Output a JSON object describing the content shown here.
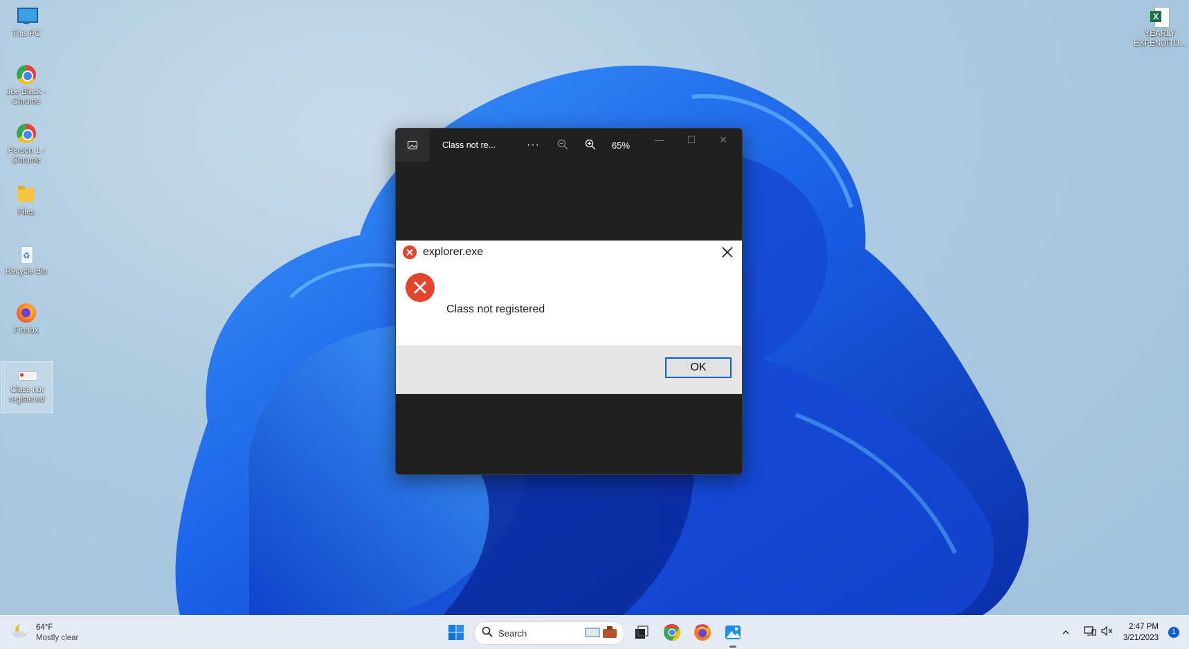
{
  "desktop": {
    "icons": [
      {
        "label": "This PC"
      },
      {
        "label": "Joe Black - Chrome"
      },
      {
        "label": "Person 1 - Chrome"
      },
      {
        "label": "Files"
      },
      {
        "label": "Recycle Bin"
      },
      {
        "label": "Firefox"
      },
      {
        "label": "Class not registered"
      },
      {
        "label": "YEARLY EXPENDITU..."
      }
    ]
  },
  "viewer": {
    "title": "Class not re...",
    "more": "···",
    "zoom": "65%",
    "icons": [
      "photo-app-icon",
      "more-icon",
      "zoom-out-icon",
      "zoom-in-icon",
      "minimize-icon",
      "maximize-icon",
      "close-icon"
    ]
  },
  "dialog": {
    "title": "explorer.exe",
    "message": "Class not registered",
    "ok_label": "OK",
    "accent": "#e3452c"
  },
  "taskbar": {
    "weather": {
      "temp": "64°F",
      "condition": "Mostly clear"
    },
    "search_label": "Search",
    "clock": {
      "time": "2:47 PM",
      "date": "3/21/2023"
    },
    "notification_count": "1",
    "icons": [
      "start-icon",
      "search-icon",
      "task-view-icon",
      "chrome-icon",
      "firefox-icon",
      "photos-icon"
    ]
  }
}
